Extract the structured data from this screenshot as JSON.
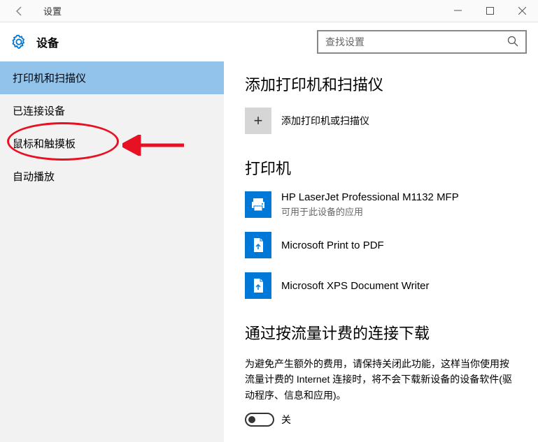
{
  "titlebar": {
    "back_icon": "←",
    "title": "设置"
  },
  "header": {
    "title": "设备"
  },
  "search": {
    "placeholder": "查找设置"
  },
  "sidebar": {
    "items": [
      {
        "label": "打印机和扫描仪",
        "active": true
      },
      {
        "label": "已连接设备",
        "active": false
      },
      {
        "label": "鼠标和触摸板",
        "active": false
      },
      {
        "label": "自动播放",
        "active": false
      }
    ]
  },
  "content": {
    "section1_title": "添加打印机和扫描仪",
    "add_label": "添加打印机或扫描仪",
    "section2_title": "打印机",
    "printers": [
      {
        "name": "HP LaserJet Professional M1132 MFP",
        "sub": "可用于此设备的应用",
        "icon": "printer"
      },
      {
        "name": "Microsoft Print to PDF",
        "sub": "",
        "icon": "pdf"
      },
      {
        "name": "Microsoft XPS Document Writer",
        "sub": "",
        "icon": "doc"
      }
    ],
    "section3_title": "通过按流量计费的连接下载",
    "metered_text": "为避免产生额外的费用，请保持关闭此功能，这样当你使用按流量计费的 Internet 连接时，将不会下载新设备的设备软件(驱动程序、信息和应用)。",
    "toggle_label": "关",
    "colors": {
      "accent": "#0078d7",
      "sidebar_active": "#91c3eb",
      "annotation": "#e81123"
    }
  }
}
